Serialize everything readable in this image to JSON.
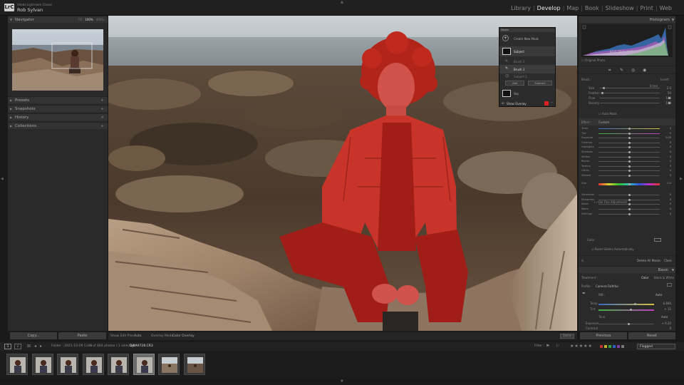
{
  "app": {
    "brand_small": "Adobe Lightroom Classic",
    "user": "Rob Sylvan",
    "logo": "LrC"
  },
  "modules": [
    "Library",
    "Develop",
    "Map",
    "Book",
    "Slideshow",
    "Print",
    "Web"
  ],
  "active_module": "Develop",
  "left_panel": {
    "navigator": {
      "title": "Navigator",
      "modes": [
        "FIT",
        "100%",
        "400%"
      ],
      "active_mode": "100%"
    },
    "sections": [
      "Presets",
      "Snapshots",
      "History",
      "Collections"
    ],
    "copy_label": "Copy...",
    "paste_label": "Paste"
  },
  "toolbar": {
    "show_edit_pins_label": "Show Edit Pins :",
    "show_edit_pins_value": "Auto",
    "overlay_mode_label": "Overlay Mode :",
    "overlay_mode_value": "Color Overlay",
    "done_label": "Done"
  },
  "masks": {
    "title": "Masks",
    "create_label": "Create New Mask",
    "items": [
      "Subject",
      "Brush 2",
      "Brush 1",
      "Subject 1"
    ],
    "add_label": "Add",
    "subtract_label": "Subtract",
    "sky_label": "Sky",
    "show_overlay_label": "Show Overlay"
  },
  "right_panel": {
    "histogram_title": "Histogram",
    "histogram_readout": [
      "62.6",
      "58.9",
      "44.7 %"
    ],
    "original_photo_label": "Original Photo",
    "brush_section": {
      "label": "Brush :",
      "erase": "Erase",
      "invert": "Invert"
    },
    "brush_rows": [
      {
        "label": "Size",
        "value": "2.0"
      },
      {
        "label": "Feather",
        "value": "50"
      },
      {
        "label": "Flow",
        "value": "100"
      },
      {
        "label": "Density",
        "value": "100"
      }
    ],
    "auto_mask_label": "Auto Mask",
    "effect_label": "Effect :",
    "custom_label": "Custom",
    "effect_rows": [
      {
        "label": "Temp",
        "value": "0"
      },
      {
        "label": "Tint",
        "value": "0"
      },
      {
        "label": "Exposure",
        "value": "0.00"
      },
      {
        "label": "Contrast",
        "value": "0"
      },
      {
        "label": "Highlights",
        "value": "0"
      },
      {
        "label": "Shadows",
        "value": "0"
      },
      {
        "label": "Whites",
        "value": "0"
      },
      {
        "label": "Blacks",
        "value": "0"
      },
      {
        "label": "Texture",
        "value": "0"
      },
      {
        "label": "Clarity",
        "value": "0"
      },
      {
        "label": "Dehaze",
        "value": "0"
      },
      {
        "label": "Hue",
        "value": "0.0"
      },
      {
        "label": "Saturation",
        "value": "0"
      },
      {
        "label": "Sharpness",
        "value": "0"
      },
      {
        "label": "Noise",
        "value": "0"
      },
      {
        "label": "Moire",
        "value": "0"
      },
      {
        "label": "Defringe",
        "value": "0"
      }
    ],
    "use_fine_adjustment_label": "Use Fine Adjustment",
    "color_label": "Color",
    "reset_sliders_label": "Reset Sliders Automatically",
    "delete_all_masks_label": "Delete All Masks",
    "close_label": "Close",
    "basic_title": "Basic",
    "treatment_label": "Treatment :",
    "treatment_color": "Color",
    "treatment_bw": "Black & White",
    "profile_label": "Profile :",
    "profile_value": "Camera Faithful",
    "wb_label": "WB :",
    "wb_value": "Auto",
    "temp_label": "Temp",
    "temp_value": "6,600",
    "tint_label": "Tint",
    "tint_value": "+ 11",
    "tone_label": "Tone",
    "tone_value": "Auto",
    "exposure_label": "Exposure",
    "exposure_value": "+ 0.32",
    "contrast_label": "Contrast",
    "contrast_value": "0",
    "previous_label": "Previous",
    "reset_label": "Reset"
  },
  "filmstrip": {
    "pages": [
      "1",
      "2"
    ],
    "source": "Folder : 2021-10-09 Colin",
    "count": "8 of 464 photos / 1 selected /",
    "filename": "DJ8A9728.CR3",
    "filter_label": "Filter :",
    "filter_value": "Flagged",
    "thumb_count": 8,
    "selected_index": 5
  },
  "colors": {
    "accent_red": "#e02020",
    "overlay_red": "#e01818"
  }
}
